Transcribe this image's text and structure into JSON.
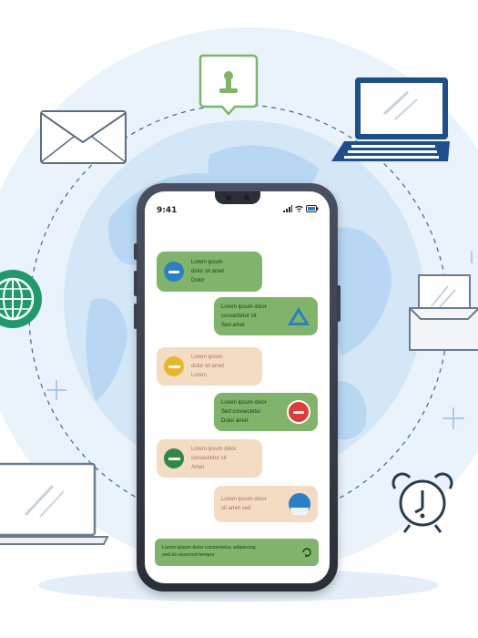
{
  "phone": {
    "status_time": "9:41",
    "messages": [
      {
        "side": "left",
        "style": "green",
        "lines": [
          "Lorem ipsum",
          "dolor sit amet",
          "Dolor"
        ],
        "icon": "minus-circle-icon",
        "icon_color": "#2b7fc7"
      },
      {
        "side": "right",
        "style": "green",
        "lines": [
          "Lorem ipsum dolor",
          "consectetur sit",
          "Sed amet"
        ],
        "icon": "warning-triangle-icon",
        "icon_color": "#2b7fc7"
      },
      {
        "side": "left",
        "style": "peach",
        "lines": [
          "Lorem ipsum",
          "dolor sit amet",
          "Lorem"
        ],
        "icon": "minus-circle-icon",
        "icon_color": "#e8b62a"
      },
      {
        "side": "right",
        "style": "green",
        "lines": [
          "Lorem ipsum dolor",
          "Sed consectetur",
          "Dolor amet"
        ],
        "icon": "no-entry-icon",
        "icon_color": "#e03a3a"
      },
      {
        "side": "left",
        "style": "peach",
        "lines": [
          "Lorem ipsum dolor",
          "consectetur sit",
          "Amet"
        ],
        "icon": "minus-circle-icon",
        "icon_color": "#2f8a45"
      },
      {
        "side": "right",
        "style": "peach",
        "lines": [
          "Lorem ipsum dolor",
          "sit amet sed"
        ],
        "icon": "user-avatar-icon",
        "icon_color": "#2b7fc7"
      }
    ],
    "input_lines": [
      "Lorem ipsum dolor consectetur, adipiscing",
      "sed do eiusmod tempor"
    ]
  },
  "colors": {
    "accent_green": "#7fb46a",
    "peach": "#f4dcc3",
    "globe_blue": "#b7d7f2",
    "navy": "#1d4f8c",
    "teal": "#1f9a6b"
  },
  "surrounding_icons": [
    "location-pin-icon",
    "laptop-icon",
    "envelope-icon",
    "globe-icon",
    "document-inbox-icon",
    "alarm-clock-icon",
    "monitor-icon"
  ]
}
